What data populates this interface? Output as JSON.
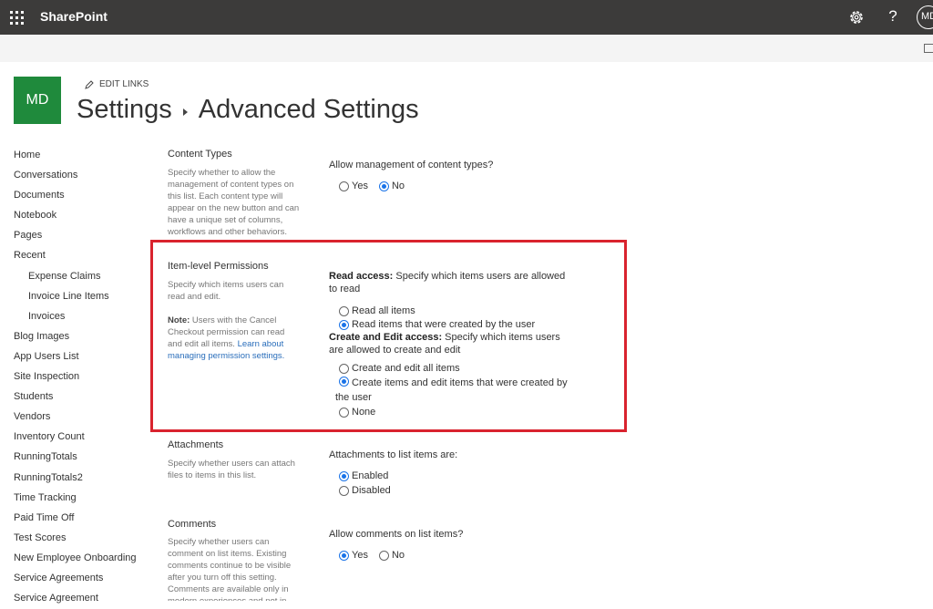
{
  "suite": {
    "brand": "SharePoint",
    "help_label": "?",
    "user_initials": "MD"
  },
  "header": {
    "site_initials": "MD",
    "edit_links": "EDIT LINKS",
    "breadcrumb_1": "Settings",
    "breadcrumb_2": "Advanced Settings"
  },
  "nav": {
    "items": [
      {
        "label": "Home"
      },
      {
        "label": "Conversations"
      },
      {
        "label": "Documents"
      },
      {
        "label": "Notebook"
      },
      {
        "label": "Pages"
      },
      {
        "label": "Recent"
      },
      {
        "label": "Expense Claims"
      },
      {
        "label": "Invoice Line Items"
      },
      {
        "label": "Invoices"
      },
      {
        "label": "Blog Images"
      },
      {
        "label": "App Users List"
      },
      {
        "label": "Site Inspection"
      },
      {
        "label": "Students"
      },
      {
        "label": "Vendors"
      },
      {
        "label": "Inventory Count"
      },
      {
        "label": "RunningTotals"
      },
      {
        "label": "RunningTotals2"
      },
      {
        "label": "Time Tracking"
      },
      {
        "label": "Paid Time Off"
      },
      {
        "label": "Test Scores"
      },
      {
        "label": "New Employee Onboarding"
      },
      {
        "label": "Service Agreements"
      },
      {
        "label": "Service Agreement"
      }
    ]
  },
  "content_types": {
    "title": "Content Types",
    "description": "Specify whether to allow the management of content types on this list. Each content type will appear on the new button and can have a unique set of columns, workflows and other behaviors.",
    "question": "Allow management of content types?",
    "yes": "Yes",
    "no": "No",
    "selected": "No"
  },
  "item_permissions": {
    "title": "Item-level Permissions",
    "description": "Specify which items users can read and edit.",
    "note_label": "Note:",
    "note_text": " Users with the Cancel Checkout permission can read and edit all items. ",
    "note_link": "Learn about managing permission settings.",
    "read_label": "Read access:",
    "read_text": "  Specify which items users are allowed to read",
    "read_all": "Read all items",
    "read_own": "Read items that were created by the user",
    "read_selected": "own",
    "edit_label": "Create and Edit access:",
    "edit_text": "  Specify which items users are allowed to create and edit",
    "edit_all": "Create and edit all items",
    "edit_own": "Create items and edit items that were created by the user",
    "edit_none": "None",
    "edit_selected": "own"
  },
  "attachments": {
    "title": "Attachments",
    "description": "Specify whether users can attach files to items in this list.",
    "question": "Attachments to list items are:",
    "enabled": "Enabled",
    "disabled": "Disabled",
    "selected": "Enabled"
  },
  "comments": {
    "title": "Comments",
    "description": "Specify whether users can comment on list items. Existing comments continue to be visible after you turn off this setting. Comments are available only in modern experiences and not in",
    "question": "Allow comments on list items?",
    "yes": "Yes",
    "no": "No",
    "selected": "Yes"
  },
  "colors": {
    "suite_bar": "#3c3b3a",
    "site_logo": "#1f8a3c",
    "highlight": "#d9232e",
    "radio_selected": "#1a73e8",
    "link": "#2a6ebb"
  }
}
